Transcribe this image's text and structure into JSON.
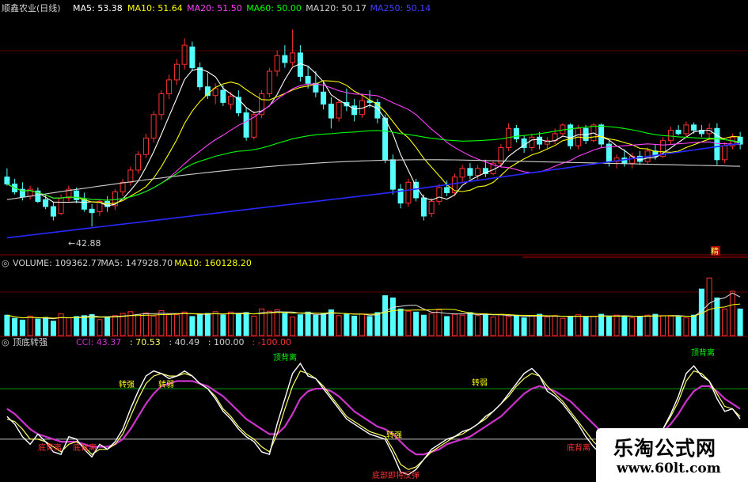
{
  "colors": {
    "up": "#ff3030",
    "down": "#54ffff",
    "ma5": "#ffffff",
    "ma10": "#ffff00",
    "ma20": "#ff40ff",
    "ma60": "#00ff00",
    "ma120": "#d0d0d0",
    "ma250": "#2828ff",
    "cci": "#ffffff",
    "cci_fast": "#ffff60",
    "cci_slow": "#cc33cc",
    "grid": "#7a0000",
    "hline_top": "#00a000",
    "hline_bottom": "#c0c0c0"
  },
  "price_panel": {
    "title": "顺鑫农业(日线)",
    "ma_labels": [
      {
        "text": "MA5: 53.38",
        "color": "#ffffff"
      },
      {
        "text": "MA10: 51.64",
        "color": "#ffff00"
      },
      {
        "text": "MA20: 51.50",
        "color": "#ff40ff"
      },
      {
        "text": "MA60: 50.00",
        "color": "#00ff00"
      },
      {
        "text": "MA120: 50.17",
        "color": "#d0d0d0"
      },
      {
        "text": "MA250: 50.14",
        "color": "#4040ff"
      }
    ],
    "low_label": "42.88"
  },
  "volume_panel": {
    "header": [
      {
        "text": "VOLUME: 109362.77",
        "color": "#d0d0d0"
      },
      {
        "text": "MA5: 147928.70",
        "color": "#d0d0d0"
      },
      {
        "text": "MA10: 160128.20",
        "color": "#ffff00"
      }
    ],
    "tag": "精"
  },
  "indicator_panel": {
    "title": "顶底转强",
    "header": [
      {
        "text": "CCI: 43.37",
        "color": "#cc33cc"
      },
      {
        "text": ": 70.53",
        "color": "#ffff60"
      },
      {
        "text": ": 40.49",
        "color": "#d0d0d0"
      },
      {
        "text": ": 100.00",
        "color": "#d0d0d0"
      },
      {
        "text": ": -100.00",
        "color": "#ff3030"
      }
    ],
    "annotations": [
      {
        "text": "顶背离",
        "color": "#00ff00"
      },
      {
        "text": "顶背离",
        "color": "#00ff00"
      },
      {
        "text": "底背离",
        "color": "#ff3030"
      },
      {
        "text": "底背离",
        "color": "#ff3030"
      },
      {
        "text": "底背离",
        "color": "#ff3030"
      },
      {
        "text": "底部即将反弹",
        "color": "#ff3030"
      },
      {
        "text": "转强",
        "color": "#ffff00"
      },
      {
        "text": "转弱",
        "color": "#ffff00"
      },
      {
        "text": "转弱",
        "color": "#ffff00"
      },
      {
        "text": "转强",
        "color": "#ffff00"
      }
    ]
  },
  "watermark": {
    "name": "乐淘公式网",
    "url": "www.60lt.com"
  },
  "chart_data": [
    {
      "type": "candlestick",
      "title": "顺鑫农业(日线)",
      "ylim": [
        40,
        67
      ],
      "candles": [
        {
          "o": 48.6,
          "h": 49.6,
          "l": 47.6,
          "c": 47.8
        },
        {
          "o": 47.8,
          "h": 48.4,
          "l": 46.6,
          "c": 46.9
        },
        {
          "o": 47.2,
          "h": 48.0,
          "l": 45.9,
          "c": 46.3
        },
        {
          "o": 46.4,
          "h": 47.6,
          "l": 46.0,
          "c": 47.2
        },
        {
          "o": 47.0,
          "h": 47.4,
          "l": 45.6,
          "c": 45.8
        },
        {
          "o": 46.0,
          "h": 46.6,
          "l": 44.9,
          "c": 45.2
        },
        {
          "o": 45.2,
          "h": 45.7,
          "l": 43.6,
          "c": 44.1
        },
        {
          "o": 44.4,
          "h": 46.6,
          "l": 44.2,
          "c": 46.2
        },
        {
          "o": 46.2,
          "h": 47.6,
          "l": 45.8,
          "c": 47.2
        },
        {
          "o": 47.0,
          "h": 47.4,
          "l": 45.6,
          "c": 46.0
        },
        {
          "o": 46.0,
          "h": 46.8,
          "l": 44.6,
          "c": 44.9
        },
        {
          "o": 44.9,
          "h": 45.5,
          "l": 42.9,
          "c": 44.5
        },
        {
          "o": 44.6,
          "h": 46.0,
          "l": 44.1,
          "c": 45.8
        },
        {
          "o": 45.8,
          "h": 46.4,
          "l": 44.6,
          "c": 45.2
        },
        {
          "o": 45.3,
          "h": 47.2,
          "l": 44.8,
          "c": 46.9
        },
        {
          "o": 46.9,
          "h": 48.4,
          "l": 46.4,
          "c": 48.0
        },
        {
          "o": 48.0,
          "h": 49.8,
          "l": 47.6,
          "c": 49.4
        },
        {
          "o": 49.4,
          "h": 51.6,
          "l": 49.0,
          "c": 51.2
        },
        {
          "o": 51.2,
          "h": 53.6,
          "l": 50.8,
          "c": 53.1
        },
        {
          "o": 53.1,
          "h": 56.2,
          "l": 52.6,
          "c": 55.8
        },
        {
          "o": 55.8,
          "h": 58.6,
          "l": 55.2,
          "c": 58.2
        },
        {
          "o": 58.2,
          "h": 60.4,
          "l": 57.6,
          "c": 59.8
        },
        {
          "o": 59.8,
          "h": 62.2,
          "l": 59.2,
          "c": 61.6
        },
        {
          "o": 61.6,
          "h": 64.6,
          "l": 61.0,
          "c": 63.8
        },
        {
          "o": 63.6,
          "h": 64.2,
          "l": 60.8,
          "c": 61.2
        },
        {
          "o": 61.2,
          "h": 61.8,
          "l": 58.6,
          "c": 59.0
        },
        {
          "o": 59.0,
          "h": 60.6,
          "l": 57.6,
          "c": 58.0
        },
        {
          "o": 58.0,
          "h": 59.4,
          "l": 57.0,
          "c": 58.8
        },
        {
          "o": 58.6,
          "h": 59.2,
          "l": 56.8,
          "c": 57.2
        },
        {
          "o": 57.0,
          "h": 58.4,
          "l": 56.4,
          "c": 57.9
        },
        {
          "o": 57.8,
          "h": 58.6,
          "l": 55.6,
          "c": 56.0
        },
        {
          "o": 56.0,
          "h": 56.6,
          "l": 52.8,
          "c": 53.2
        },
        {
          "o": 53.2,
          "h": 56.2,
          "l": 52.9,
          "c": 55.8
        },
        {
          "o": 55.8,
          "h": 58.6,
          "l": 55.4,
          "c": 58.2
        },
        {
          "o": 58.2,
          "h": 61.2,
          "l": 57.8,
          "c": 60.8
        },
        {
          "o": 60.8,
          "h": 63.2,
          "l": 60.2,
          "c": 62.6
        },
        {
          "o": 62.6,
          "h": 63.8,
          "l": 61.2,
          "c": 61.8
        },
        {
          "o": 61.8,
          "h": 65.6,
          "l": 61.4,
          "c": 62.9
        },
        {
          "o": 62.9,
          "h": 63.8,
          "l": 59.6,
          "c": 60.2
        },
        {
          "o": 60.2,
          "h": 61.4,
          "l": 58.8,
          "c": 59.4
        },
        {
          "o": 59.4,
          "h": 60.8,
          "l": 57.8,
          "c": 58.4
        },
        {
          "o": 58.4,
          "h": 59.6,
          "l": 56.4,
          "c": 57.0
        },
        {
          "o": 57.0,
          "h": 57.8,
          "l": 54.2,
          "c": 55.4
        },
        {
          "o": 55.4,
          "h": 57.6,
          "l": 55.0,
          "c": 57.2
        },
        {
          "o": 57.2,
          "h": 58.8,
          "l": 56.2,
          "c": 56.8
        },
        {
          "o": 56.8,
          "h": 57.6,
          "l": 55.0,
          "c": 55.8
        },
        {
          "o": 55.8,
          "h": 58.0,
          "l": 55.4,
          "c": 57.4
        },
        {
          "o": 57.4,
          "h": 58.6,
          "l": 56.6,
          "c": 57.2
        },
        {
          "o": 57.2,
          "h": 57.6,
          "l": 54.8,
          "c": 55.4
        },
        {
          "o": 55.4,
          "h": 55.8,
          "l": 50.2,
          "c": 50.6
        },
        {
          "o": 50.6,
          "h": 51.2,
          "l": 46.6,
          "c": 47.2
        },
        {
          "o": 47.2,
          "h": 47.8,
          "l": 45.0,
          "c": 45.6
        },
        {
          "o": 45.6,
          "h": 48.4,
          "l": 45.2,
          "c": 48.0
        },
        {
          "o": 48.0,
          "h": 48.4,
          "l": 45.8,
          "c": 46.2
        },
        {
          "o": 46.2,
          "h": 46.6,
          "l": 43.6,
          "c": 44.1
        },
        {
          "o": 44.4,
          "h": 46.2,
          "l": 44.0,
          "c": 45.8
        },
        {
          "o": 45.8,
          "h": 47.8,
          "l": 45.4,
          "c": 47.4
        },
        {
          "o": 47.4,
          "h": 48.2,
          "l": 46.4,
          "c": 46.8
        },
        {
          "o": 46.8,
          "h": 49.0,
          "l": 46.4,
          "c": 48.6
        },
        {
          "o": 48.6,
          "h": 50.0,
          "l": 48.0,
          "c": 49.6
        },
        {
          "o": 49.6,
          "h": 50.2,
          "l": 48.4,
          "c": 48.8
        },
        {
          "o": 48.8,
          "h": 50.0,
          "l": 48.2,
          "c": 49.6
        },
        {
          "o": 49.6,
          "h": 50.6,
          "l": 48.6,
          "c": 49.0
        },
        {
          "o": 49.0,
          "h": 50.4,
          "l": 48.8,
          "c": 50.2
        },
        {
          "o": 50.2,
          "h": 52.4,
          "l": 49.8,
          "c": 52.0
        },
        {
          "o": 52.0,
          "h": 54.8,
          "l": 51.6,
          "c": 54.2
        },
        {
          "o": 54.2,
          "h": 54.6,
          "l": 52.6,
          "c": 53.0
        },
        {
          "o": 53.0,
          "h": 53.4,
          "l": 51.4,
          "c": 52.0
        },
        {
          "o": 52.0,
          "h": 53.6,
          "l": 51.6,
          "c": 53.2
        },
        {
          "o": 53.2,
          "h": 53.8,
          "l": 51.8,
          "c": 52.4
        },
        {
          "o": 52.4,
          "h": 53.2,
          "l": 51.8,
          "c": 52.8
        },
        {
          "o": 52.8,
          "h": 54.2,
          "l": 52.4,
          "c": 53.6
        },
        {
          "o": 53.6,
          "h": 54.8,
          "l": 53.4,
          "c": 54.6
        },
        {
          "o": 54.6,
          "h": 54.8,
          "l": 51.8,
          "c": 52.2
        },
        {
          "o": 52.2,
          "h": 54.6,
          "l": 51.8,
          "c": 54.2
        },
        {
          "o": 54.2,
          "h": 54.6,
          "l": 52.4,
          "c": 52.8
        },
        {
          "o": 52.8,
          "h": 54.8,
          "l": 52.6,
          "c": 54.6
        },
        {
          "o": 54.6,
          "h": 54.8,
          "l": 52.0,
          "c": 52.4
        },
        {
          "o": 52.4,
          "h": 52.8,
          "l": 49.8,
          "c": 50.4
        },
        {
          "o": 50.4,
          "h": 51.2,
          "l": 49.6,
          "c": 50.8
        },
        {
          "o": 50.8,
          "h": 51.8,
          "l": 49.8,
          "c": 50.2
        },
        {
          "o": 50.2,
          "h": 51.4,
          "l": 49.6,
          "c": 51.0
        },
        {
          "o": 51.0,
          "h": 51.6,
          "l": 50.0,
          "c": 50.4
        },
        {
          "o": 50.4,
          "h": 52.0,
          "l": 50.0,
          "c": 51.6
        },
        {
          "o": 51.6,
          "h": 52.4,
          "l": 50.6,
          "c": 51.0
        },
        {
          "o": 51.0,
          "h": 53.2,
          "l": 50.8,
          "c": 52.8
        },
        {
          "o": 52.8,
          "h": 54.4,
          "l": 52.4,
          "c": 54.0
        },
        {
          "o": 54.0,
          "h": 54.6,
          "l": 53.4,
          "c": 53.6
        },
        {
          "o": 53.6,
          "h": 55.0,
          "l": 53.2,
          "c": 54.6
        },
        {
          "o": 54.6,
          "h": 54.9,
          "l": 53.6,
          "c": 54.0
        },
        {
          "o": 54.0,
          "h": 54.6,
          "l": 53.2,
          "c": 53.6
        },
        {
          "o": 53.6,
          "h": 54.8,
          "l": 53.0,
          "c": 54.2
        },
        {
          "o": 54.2,
          "h": 54.8,
          "l": 50.0,
          "c": 50.6
        },
        {
          "o": 50.6,
          "h": 52.6,
          "l": 50.2,
          "c": 52.2
        },
        {
          "o": 52.2,
          "h": 53.6,
          "l": 51.8,
          "c": 53.2
        },
        {
          "o": 53.2,
          "h": 53.8,
          "l": 51.8,
          "c": 52.4
        }
      ],
      "low_marker": 42.88
    },
    {
      "type": "bar",
      "title": "VOLUME",
      "ylim": [
        0,
        300000
      ],
      "values": [
        92000,
        78000,
        70000,
        88000,
        75000,
        82000,
        65000,
        98000,
        80000,
        86000,
        90000,
        95000,
        72000,
        84000,
        90000,
        100000,
        108000,
        95000,
        102000,
        88000,
        112000,
        98000,
        94000,
        106000,
        86000,
        94000,
        100000,
        108000,
        92000,
        106000,
        98000,
        104000,
        88000,
        120000,
        110000,
        116000,
        100000,
        84000,
        94000,
        106000,
        92000,
        100000,
        116000,
        90000,
        96000,
        88000,
        98000,
        86000,
        104000,
        180000,
        170000,
        120000,
        110000,
        106000,
        92000,
        100000,
        116000,
        86000,
        96000,
        92000,
        104000,
        90000,
        98000,
        84000,
        94000,
        86000,
        92000,
        80000,
        88000,
        96000,
        84000,
        90000,
        78000,
        86000,
        94000,
        82000,
        88000,
        96000,
        84000,
        92000,
        88000,
        80000,
        86000,
        92000,
        96000,
        90000,
        88000,
        84000,
        80000,
        92000,
        210000,
        260000,
        170000,
        120000,
        200000,
        120000
      ],
      "ma_labels": {
        "volume": 109362.77,
        "ma5": 147928.7,
        "ma10": 160128.2
      }
    },
    {
      "type": "line",
      "title": "顶底转强",
      "ylim": [
        -260,
        260
      ],
      "reference_lines": [
        100,
        -100
      ],
      "series": [
        {
          "name": "CCI",
          "values": [
            -10,
            -40,
            -90,
            -120,
            -80,
            -110,
            -150,
            -160,
            -90,
            -100,
            -140,
            -170,
            -120,
            -140,
            -110,
            -60,
            20,
            90,
            150,
            170,
            160,
            140,
            150,
            170,
            150,
            120,
            100,
            60,
            10,
            -20,
            -60,
            -90,
            -110,
            -150,
            -160,
            -40,
            60,
            160,
            200,
            150,
            140,
            100,
            60,
            20,
            -20,
            -40,
            -60,
            -80,
            -90,
            -100,
            -160,
            -230,
            -240,
            -220,
            -180,
            -140,
            -120,
            -100,
            -90,
            -70,
            -60,
            -40,
            -10,
            10,
            40,
            80,
            120,
            160,
            180,
            150,
            90,
            70,
            40,
            0,
            -40,
            -90,
            -130,
            -160,
            -150,
            -170,
            -160,
            -140,
            -150,
            -120,
            -80,
            -60,
            0,
            70,
            160,
            190,
            150,
            130,
            60,
            10,
            20,
            -20
          ]
        },
        {
          "values": [
            -20,
            -30,
            -60,
            -100,
            -100,
            -110,
            -130,
            -150,
            -120,
            -110,
            -130,
            -160,
            -140,
            -140,
            -120,
            -80,
            -10,
            60,
            120,
            150,
            160,
            150,
            150,
            160,
            150,
            120,
            100,
            70,
            20,
            -10,
            -50,
            -80,
            -100,
            -130,
            -150,
            -80,
            20,
            110,
            170,
            160,
            140,
            110,
            70,
            30,
            -10,
            -30,
            -50,
            -70,
            -80,
            -90,
            -140,
            -200,
            -220,
            -210,
            -180,
            -150,
            -130,
            -110,
            -90,
            -80,
            -60,
            -40,
            -20,
            10,
            40,
            70,
            110,
            140,
            160,
            150,
            110,
            80,
            50,
            10,
            -30,
            -70,
            -110,
            -140,
            -150,
            -160,
            -160,
            -150,
            -140,
            -120,
            -90,
            -60,
            -10,
            50,
            130,
            170,
            160,
            130,
            80,
            30,
            20,
            -10
          ]
        },
        {
          "values": [
            20,
            0,
            -30,
            -60,
            -80,
            -90,
            -100,
            -110,
            -110,
            -110,
            -120,
            -130,
            -130,
            -130,
            -120,
            -100,
            -60,
            -10,
            40,
            80,
            110,
            120,
            130,
            130,
            130,
            120,
            110,
            90,
            70,
            40,
            10,
            -20,
            -40,
            -60,
            -80,
            -80,
            -50,
            0,
            60,
            90,
            100,
            100,
            90,
            70,
            40,
            10,
            -10,
            -30,
            -50,
            -60,
            -80,
            -110,
            -140,
            -160,
            -160,
            -150,
            -140,
            -120,
            -110,
            -100,
            -90,
            -70,
            -50,
            -30,
            -10,
            20,
            50,
            80,
            100,
            110,
            100,
            90,
            70,
            50,
            20,
            -10,
            -40,
            -70,
            -90,
            -110,
            -120,
            -120,
            -120,
            -110,
            -90,
            -70,
            -40,
            0,
            50,
            90,
            110,
            110,
            90,
            60,
            40,
            20
          ]
        }
      ],
      "header_values": {
        "CCI": 43.37,
        "v1": 70.53,
        "v2": 40.49,
        "upper": 100.0,
        "lower": -100.0
      }
    }
  ]
}
